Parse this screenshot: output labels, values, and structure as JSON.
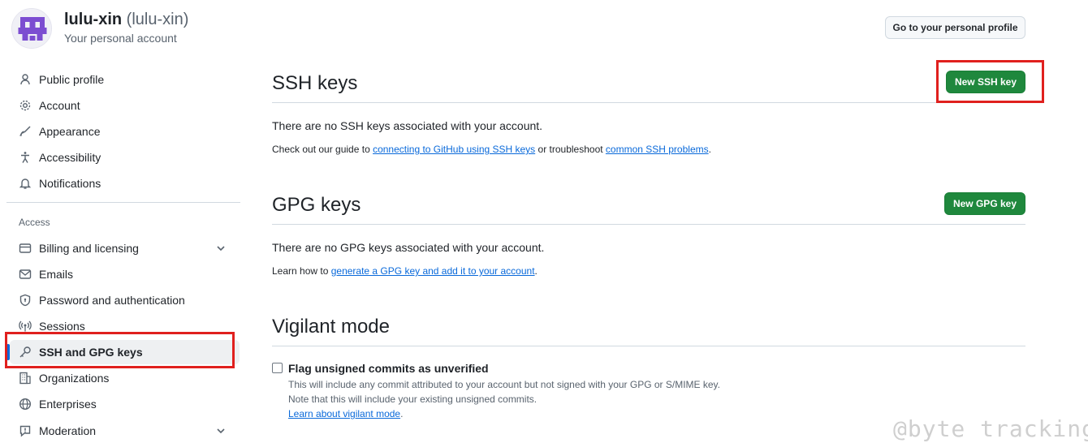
{
  "account": {
    "username": "lulu-xin",
    "handle": "(lulu-xin)",
    "subtitle": "Your personal account",
    "profile_button": "Go to your personal profile"
  },
  "sidebar": {
    "items_top": [
      {
        "label": "Public profile",
        "icon": "person-icon"
      },
      {
        "label": "Account",
        "icon": "gear-icon"
      },
      {
        "label": "Appearance",
        "icon": "paintbrush-icon"
      },
      {
        "label": "Accessibility",
        "icon": "accessibility-icon"
      },
      {
        "label": "Notifications",
        "icon": "bell-icon"
      }
    ],
    "access_heading": "Access",
    "items_access": [
      {
        "label": "Billing and licensing",
        "icon": "credit-card-icon",
        "expandable": true
      },
      {
        "label": "Emails",
        "icon": "mail-icon"
      },
      {
        "label": "Password and authentication",
        "icon": "shield-lock-icon"
      },
      {
        "label": "Sessions",
        "icon": "broadcast-icon"
      },
      {
        "label": "SSH and GPG keys",
        "icon": "key-icon",
        "active": true
      },
      {
        "label": "Organizations",
        "icon": "organization-icon"
      },
      {
        "label": "Enterprises",
        "icon": "globe-icon"
      },
      {
        "label": "Moderation",
        "icon": "report-icon",
        "expandable": true
      }
    ]
  },
  "ssh": {
    "title": "SSH keys",
    "button": "New SSH key",
    "empty": "There are no SSH keys associated with your account.",
    "guide_prefix": "Check out our guide to ",
    "guide_link": "connecting to GitHub using SSH keys",
    "guide_middle": " or troubleshoot ",
    "problems_link": "common SSH problems",
    "guide_suffix": "."
  },
  "gpg": {
    "title": "GPG keys",
    "button": "New GPG key",
    "empty": "There are no GPG keys associated with your account.",
    "learn_prefix": "Learn how to ",
    "learn_link": "generate a GPG key and add it to your account",
    "learn_suffix": "."
  },
  "vigilant": {
    "title": "Vigilant mode",
    "checkbox_label": "Flag unsigned commits as unverified",
    "checked": false,
    "note1": "This will include any commit attributed to your account but not signed with your GPG or S/MIME key.",
    "note2": "Note that this will include your existing unsigned commits.",
    "learn_link": "Learn about vigilant mode",
    "learn_suffix": "."
  },
  "watermark": "@byte tracking",
  "colors": {
    "primary_button": "#1f883d",
    "link": "#0969da",
    "highlight": "#e0201e",
    "avatar": "#7c4dd1"
  }
}
